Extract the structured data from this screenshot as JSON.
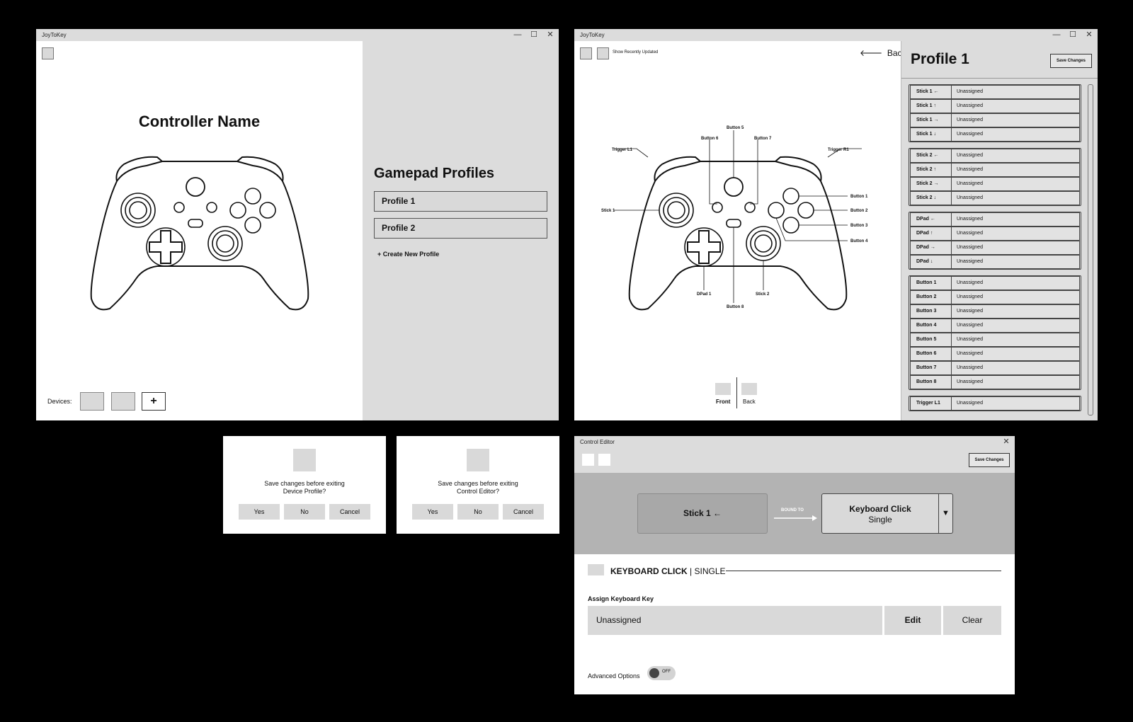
{
  "app_title": "JoyToKey",
  "window_controls": {
    "minimize": "—",
    "maximize": "☐",
    "close": "✕"
  },
  "home": {
    "controller_name": "Controller Name",
    "profiles_title": "Gamepad Profiles",
    "profiles": [
      "Profile 1",
      "Profile 2"
    ],
    "create_profile": "+ Create New Profile",
    "devices_label": "Devices:",
    "add_device": "+"
  },
  "editor": {
    "show_recent": "Show Recently Updated",
    "back": "Back",
    "back_icon": "arrow-left-icon",
    "profile_title": "Profile 1",
    "save_changes": "Save Changes",
    "views": {
      "front": "Front",
      "back": "Back"
    },
    "callouts": {
      "trigger_l1": "Trigger L1",
      "trigger_r1": "Trigger R1",
      "button_5": "Button 5",
      "button_6": "Button 6",
      "button_7": "Button 7",
      "button_1": "Button 1",
      "button_2": "Button 2",
      "button_3": "Button 3",
      "button_4": "Button 4",
      "button_8": "Button 8",
      "stick_1": "Stick 1",
      "stick_2": "Stick 2",
      "dpad_1": "DPad 1"
    },
    "mappings": [
      {
        "control": "Stick 1 ←",
        "value": "Unassigned"
      },
      {
        "control": "Stick 1 ↑",
        "value": "Unassigned"
      },
      {
        "control": "Stick 1 →",
        "value": "Unassigned"
      },
      {
        "control": "Stick 1 ↓",
        "value": "Unassigned"
      },
      {
        "control": "Stick 2 ←",
        "value": "Unassigned"
      },
      {
        "control": "Stick 2 ↑",
        "value": "Unassigned"
      },
      {
        "control": "Stick 2 →",
        "value": "Unassigned"
      },
      {
        "control": "Stick 2 ↓",
        "value": "Unassigned"
      },
      {
        "control": "DPad ←",
        "value": "Unassigned"
      },
      {
        "control": "DPad ↑",
        "value": "Unassigned"
      },
      {
        "control": "DPad →",
        "value": "Unassigned"
      },
      {
        "control": "DPad ↓",
        "value": "Unassigned"
      },
      {
        "control": "Button 1",
        "value": "Unassigned"
      },
      {
        "control": "Button 2",
        "value": "Unassigned"
      },
      {
        "control": "Button 3",
        "value": "Unassigned"
      },
      {
        "control": "Button 4",
        "value": "Unassigned"
      },
      {
        "control": "Button 5",
        "value": "Unassigned"
      },
      {
        "control": "Button 6",
        "value": "Unassigned"
      },
      {
        "control": "Button 7",
        "value": "Unassigned"
      },
      {
        "control": "Button 8",
        "value": "Unassigned"
      },
      {
        "control": "Trigger L1",
        "value": "Unassigned"
      }
    ]
  },
  "dialogs": [
    {
      "line1": "Save changes before exiting",
      "line2": "Device Profile?",
      "yes": "Yes",
      "no": "No",
      "cancel": "Cancel"
    },
    {
      "line1": "Save changes before exiting",
      "line2": "Control Editor?",
      "yes": "Yes",
      "no": "No",
      "cancel": "Cancel"
    }
  ],
  "control_editor": {
    "title": "Control Editor",
    "save_changes": "Save Changes",
    "source": "Stick 1 ←",
    "bound_to": "BOUND TO",
    "action": "Keyboard Click",
    "action_mode": "Single",
    "dropdown_icon": "▼",
    "section_action": "KEYBOARD CLICK",
    "section_sep": "|",
    "section_mode": "SINGLE",
    "assign_label": "Assign Keyboard Key",
    "assign_value": "Unassigned",
    "edit": "Edit",
    "clear": "Clear",
    "advanced_label": "Advanced Options",
    "advanced_state": "OFF"
  }
}
